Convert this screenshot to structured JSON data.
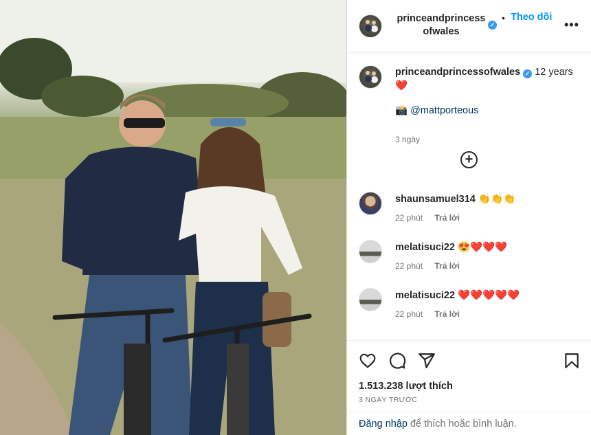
{
  "post": {
    "username": "princeandprincessofwales",
    "username_line1": "princeandprincess",
    "username_line2": "ofwales",
    "follow_label": "Theo dõi",
    "more_label": "•••",
    "caption_text": "12 years",
    "caption_emoji": "❤️",
    "credit_emoji": "📸",
    "credit": "@mattporteous",
    "caption_time": "3 ngày",
    "load_more_label": "+"
  },
  "comments": [
    {
      "username": "shaunsamuel314",
      "text": "👏👏👏",
      "time": "22 phút",
      "reply": "Trả lời"
    },
    {
      "username": "melatisuci22",
      "text": "😍❤️❤️❤️",
      "time": "22 phút",
      "reply": "Trả lời"
    },
    {
      "username": "melatisuci22",
      "text": "❤️❤️❤️❤️❤️",
      "time": "22 phút",
      "reply": "Trả lời"
    }
  ],
  "footer": {
    "likes": "1.513.238 lượt thích",
    "posted": "3 NGÀY TRƯỚC",
    "login_link": "Đăng nhập",
    "login_rest": " để thích hoặc bình luận."
  },
  "icons": {
    "like": "heart-outline-icon",
    "comment": "speech-bubble-icon",
    "share": "paper-plane-icon",
    "save": "bookmark-icon",
    "verified": "verified-badge-icon"
  },
  "colors": {
    "link_blue": "#0095f6",
    "verified_blue": "#3897f0",
    "heart_red": "#ed4956"
  }
}
